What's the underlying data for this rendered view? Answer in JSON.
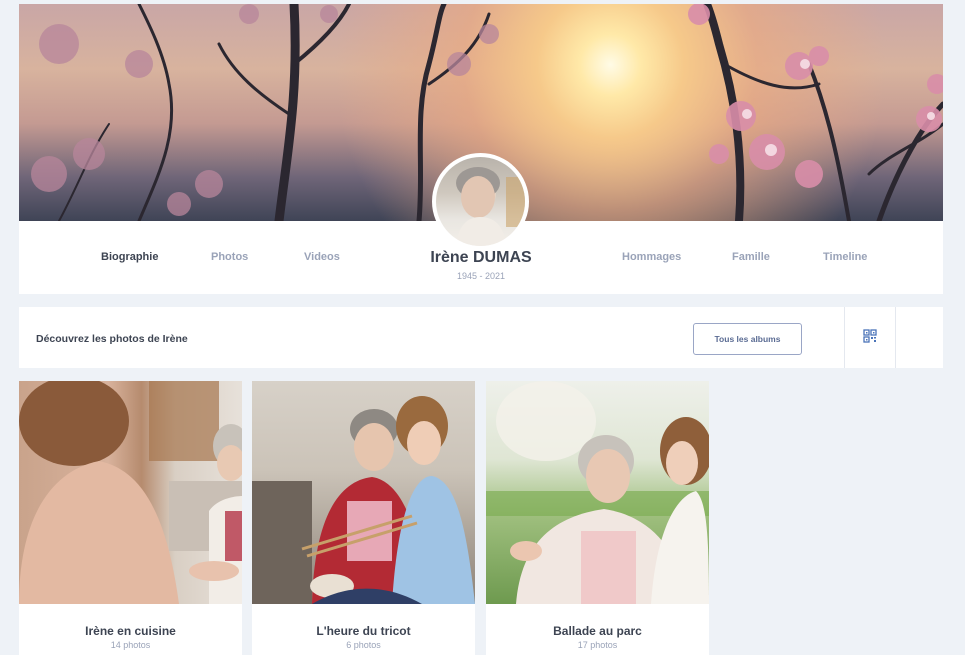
{
  "profile": {
    "name": "Irène DUMAS",
    "dates": "1945 - 2021"
  },
  "nav": {
    "left": [
      "Biographie",
      "Photos",
      "Videos"
    ],
    "right": [
      "Hommages",
      "Famille",
      "Timeline"
    ],
    "active": "Biographie"
  },
  "photos_section": {
    "title": "Découvrez les photos de Irène",
    "albums_button": "Tous les albums",
    "view_icon": "qr-grid-icon"
  },
  "albums": [
    {
      "title": "Irène en cuisine",
      "count": "14 photos"
    },
    {
      "title": "L'heure du tricot",
      "count": "6 photos"
    },
    {
      "title": "Ballade au parc",
      "count": "17 photos"
    }
  ],
  "colors": {
    "background": "#eef2f7",
    "text_dark": "#3d4452",
    "text_muted": "#9aa3b8",
    "accent": "#5a6b93"
  }
}
